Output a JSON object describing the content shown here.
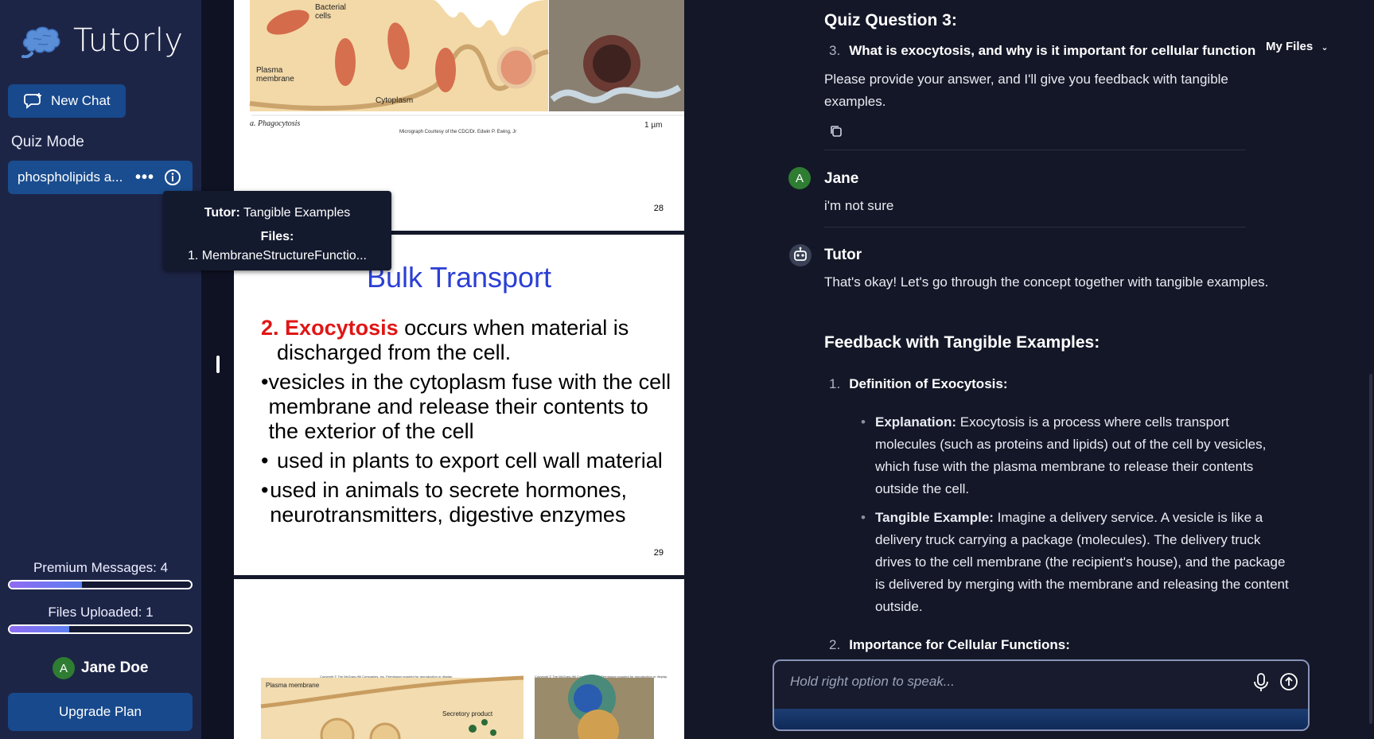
{
  "app": {
    "name": "Tutorly"
  },
  "sidebar": {
    "new_chat": "New Chat",
    "section": "Quiz Mode",
    "chat_item": "phospholipids a...",
    "premium_label": "Premium Messages: 4",
    "premium_fraction": 0.4,
    "files_label": "Files Uploaded: 1",
    "files_fraction": 0.33,
    "user_initial": "A",
    "user_name": "Jane Doe",
    "upgrade": "Upgrade Plan"
  },
  "tooltip": {
    "tutor_label": "Tutor:",
    "tutor_value": "Tangible Examples",
    "files_label": "Files:",
    "file1": "1. MembraneStructureFunctio..."
  },
  "pdf": {
    "page28": {
      "label_bacterial": "Bacterial",
      "label_cells": "cells",
      "label_plasma": "Plasma",
      "label_membrane": "membrane",
      "label_cytoplasm": "Cytoplasm",
      "caption": "a. Phagocytosis",
      "credit": "Micrograph Courtesy of the CDC/Dr. Edwin P. Ewing, Jr",
      "scale": "1 µm",
      "page_num": "28"
    },
    "page29": {
      "title": "Bulk Transport",
      "num": "2.",
      "term": "Exocytosis",
      "rest1": " occurs when material is",
      "line2": "discharged from the cell.",
      "bullets": [
        "vesicles in the cytoplasm fuse with the cell membrane and release their contents to the exterior of the cell",
        "used in plants to export cell wall material",
        "used in animals to secrete hormones, neurotransmitters, digestive enzymes"
      ],
      "page_num": "29"
    },
    "page30": {
      "copyright1": "Copyright © The McGraw-Hill Companies, Inc. Permission required for reproduction or display.",
      "copyright2": "Copyright © The McGraw-Hill Companies, Inc. Permission required for reproduction or display.",
      "label_plasma": "Plasma membrane",
      "label_secretory": "Secretory product"
    }
  },
  "chat": {
    "quiz_title": "Quiz Question 3:",
    "q_num": "3.",
    "question": "What is exocytosis, and why is it important for cellular function",
    "my_files": "My Files",
    "prompt": "Please provide your answer, and I'll give you feedback with tangible examples.",
    "user_initial": "A",
    "user_name": "Jane",
    "user_msg": "i'm not sure",
    "tutor_name": "Tutor",
    "tutor_msg": "That's okay! Let's go through the concept together with tangible examples.",
    "heading": "Feedback with Tangible Examples:",
    "item1_num": "1.",
    "item1": "Definition of Exocytosis:",
    "exp_label": "Explanation:",
    "exp_text": " Exocytosis is a process where cells transport molecules (such as proteins and lipids) out of the cell by vesicles, which fuse with the plasma membrane to release their contents outside the cell.",
    "ex_label": "Tangible Example:",
    "ex_text": " Imagine a delivery service. A vesicle is like a delivery truck carrying a package (molecules). The delivery truck drives to the cell membrane (the recipient's house), and the package is delivered by merging with the membrane and releasing the content outside.",
    "item2_num": "2.",
    "item2": "Importance for Cellular Functions:",
    "input_placeholder": "Hold right option to speak..."
  }
}
